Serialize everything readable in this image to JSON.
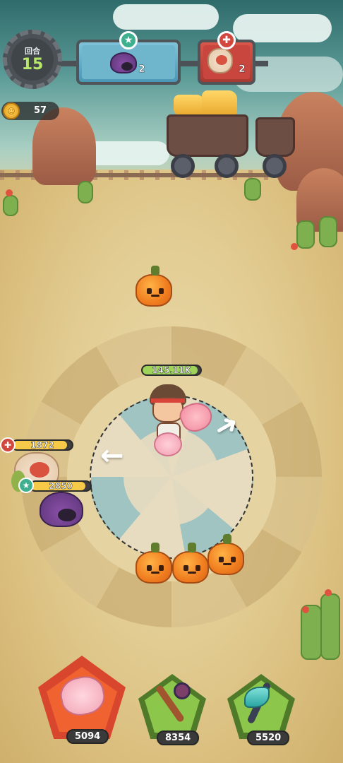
{
  "hud": {
    "round_label": "回合",
    "round_number": "15",
    "ally_team": {
      "icon": "purple-hedgehog-icon",
      "count": "2",
      "badge": "★"
    },
    "enemy_team": {
      "icon": "sheep-monster-icon",
      "count": "2",
      "badge": "✚"
    },
    "coins": "57"
  },
  "hero": {
    "hp_text": "145.11K",
    "hp_fraction": 0.95
  },
  "enemies": [
    {
      "name": "sheep-monster",
      "hp_text": "1872",
      "badge": "✚",
      "hp_fraction": 0.92
    },
    {
      "name": "purple-hedgehog",
      "hp_text": "2850",
      "badge": "★",
      "hp_fraction": 0.92
    }
  ],
  "arena": {
    "left_arrow": "←",
    "right_arrow": "➜"
  },
  "skills": [
    {
      "icon": "pig-hammer-icon",
      "value": "5094"
    },
    {
      "icon": "magic-wand-icon",
      "value": "8354"
    },
    {
      "icon": "ice-axe-icon",
      "value": "5520"
    }
  ],
  "colors": {
    "ally_accent": "#3fb08f",
    "enemy_accent": "#d2473e",
    "hp_fill": "#f7c948",
    "hero_hp_fill": "#9fd45a"
  }
}
